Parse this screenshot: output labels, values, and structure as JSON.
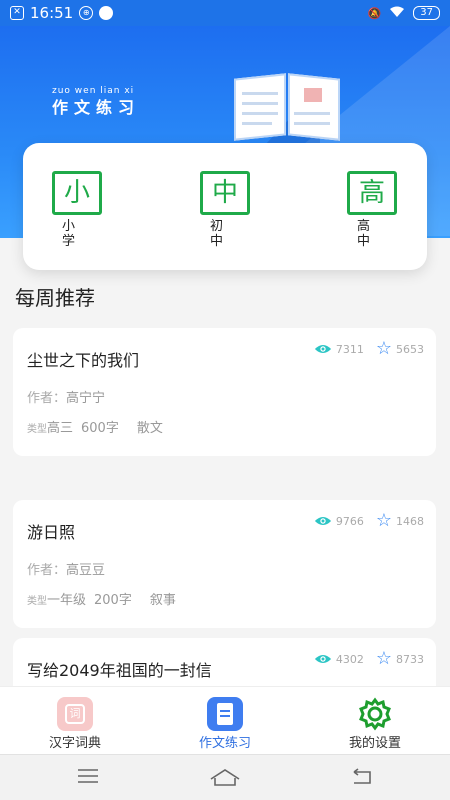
{
  "status": {
    "time": "16:51",
    "battery": "37"
  },
  "banner": {
    "pinyin": "zuo wen lian xi",
    "title": "作文练习"
  },
  "levels": [
    {
      "char": "小",
      "label": "小学"
    },
    {
      "char": "中",
      "label": "初中"
    },
    {
      "char": "高",
      "label": "高中"
    }
  ],
  "section_title": "每周推荐",
  "essays": [
    {
      "title": "尘世之下的我们",
      "author_label": "作者：",
      "author": "高宁宁",
      "type_label": "类型",
      "grade": "高三",
      "words": "600字",
      "genre": "散文",
      "views": "7311",
      "stars": "5653"
    },
    {
      "title": "游日照",
      "author_label": "作者：",
      "author": "高豆豆",
      "type_label": "类型",
      "grade": "一年级",
      "words": "200字",
      "genre": "叙事",
      "views": "9766",
      "stars": "1468"
    },
    {
      "title": "写给2049年祖国的一封信",
      "views": "4302",
      "stars": "8733"
    }
  ],
  "tabs": [
    {
      "label": "汉字词典",
      "icon_text": "词"
    },
    {
      "label": "作文练习"
    },
    {
      "label": "我的设置"
    }
  ],
  "colors": {
    "primary": "#1e73e8",
    "green": "#1faa49",
    "accent": "#2f6fe0",
    "teal": "#2cc5c5"
  }
}
